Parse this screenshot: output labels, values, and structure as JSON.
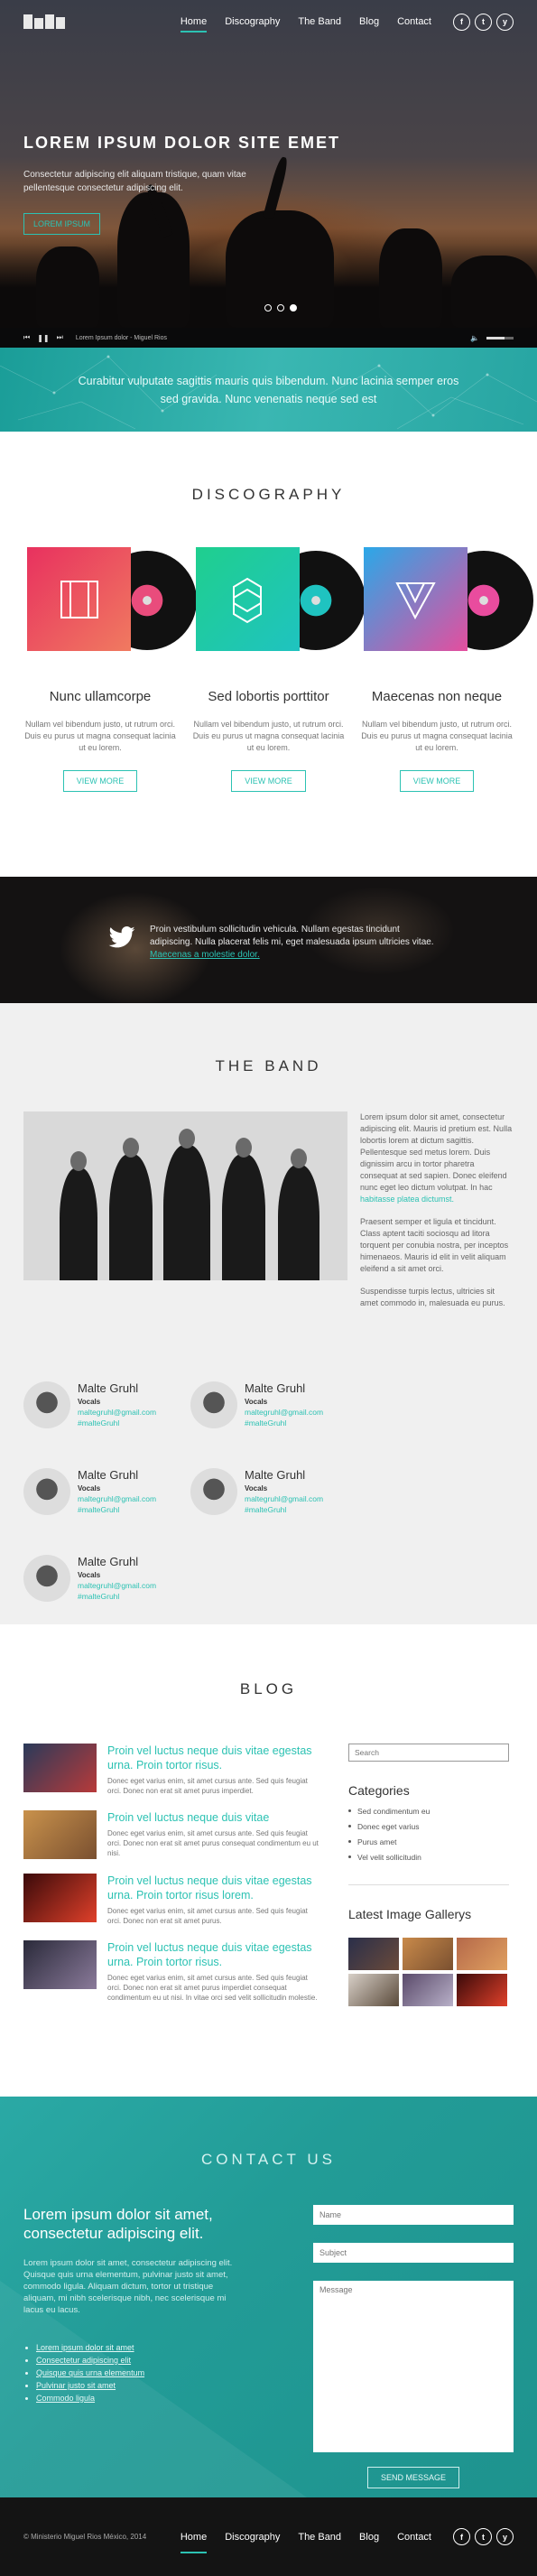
{
  "nav": {
    "items": [
      "Home",
      "Discography",
      "The Band",
      "Blog",
      "Contact"
    ],
    "active": "Home",
    "social": [
      "f",
      "t",
      "y"
    ]
  },
  "hero": {
    "title": "LOREM IPSUM DOLOR SITE EMET",
    "subtitle": "Consectetur adipiscing elit aliquam tristique, quam vitae pellentesque consectetur adipiscing elit.",
    "button": "LOREM IPSUM",
    "player_track": "Lorem Ipsum dolor - Miguel Rios"
  },
  "quote": {
    "text": "Curabitur vulputate sagittis mauris quis bibendum. Nunc lacinia semper eros sed gravida. Nunc venenatis neque sed est"
  },
  "discography": {
    "title": "DISCOGRAPHY",
    "albums": [
      {
        "name": "Nunc ullamcorpe",
        "text": "Nullam vel bibendum justo, ut rutrum orci. Duis eu purus ut magna consequat lacinia ut eu lorem.",
        "button": "VIEW MORE",
        "c1": "#e8315f",
        "c2": "#f07a60",
        "label": "#e94c7c"
      },
      {
        "name": "Sed lobortis porttitor",
        "text": "Nullam vel bibendum justo, ut rutrum orci. Duis eu purus ut magna consequat lacinia ut eu lorem.",
        "button": "VIEW MORE",
        "c1": "#1fcf8e",
        "c2": "#1fc3c0",
        "label": "#1fc3c0"
      },
      {
        "name": "Maecenas non neque",
        "text": "Nullam vel bibendum justo, ut rutrum orci. Duis eu purus ut magna consequat lacinia ut eu lorem.",
        "button": "VIEW MORE",
        "c1": "#2aa8e8",
        "c2": "#e54e9e",
        "label": "#e94c9e"
      }
    ]
  },
  "tweet": {
    "text": "Proin vestibulum sollicitudin vehicula. Nullam egestas tincidunt adipiscing. Nulla placerat felis mi, eget malesuada ipsum ultricies vitae.",
    "link": "Maecenas a molestie dolor."
  },
  "band": {
    "title": "THE BAND",
    "p1": "Lorem ipsum dolor sit amet, consectetur adipiscing elit. Mauris id pretium est. Nulla lobortis lorem at dictum sagittis. Pellentesque sed metus lorem. Duis dignissim arcu in tortor pharetra consequat at sed sapien. Donec eleifend nunc eget leo dictum volutpat. In hac",
    "p1_link": "habitasse platea dictumst.",
    "p2": "Praesent semper et ligula et tincidunt. Class aptent taciti sociosqu ad litora torquent per conubia nostra, per inceptos himenaeos. Mauris id elit in velit aliquam eleifend a sit amet orci.",
    "p3": "Suspendisse turpis lectus, ultricies sit amet commodo in, malesuada eu purus.",
    "members": [
      {
        "name": "Malte Gruhl",
        "role": "Vocals",
        "email": "maltegruhl@gmail.com",
        "tag": "#malteGruhl"
      },
      {
        "name": "Malte Gruhl",
        "role": "Vocals",
        "email": "maltegruhl@gmail.com",
        "tag": "#malteGruhl"
      },
      {
        "name": "Malte Gruhl",
        "role": "Vocals",
        "email": "maltegruhl@gmail.com",
        "tag": "#malteGruhl"
      },
      {
        "name": "Malte Gruhl",
        "role": "Vocals",
        "email": "maltegruhl@gmail.com",
        "tag": "#malteGruhl"
      },
      {
        "name": "Malte Gruhl",
        "role": "Vocals",
        "email": "maltegruhl@gmail.com",
        "tag": "#malteGruhl"
      }
    ]
  },
  "blog": {
    "title": "BLOG",
    "posts": [
      {
        "title": "Proin vel luctus neque duis vitae egestas urna. Proin tortor risus.",
        "text": "Donec eget varius enim, sit amet cursus ante. Sed quis feugiat orci. Donec non erat sit amet purus imperdiet.",
        "c1": "#2a3a5a",
        "c2": "#b83a3a"
      },
      {
        "title": "Proin vel luctus neque duis vitae",
        "text": "Donec eget varius enim, sit amet cursus ante. Sed quis feugiat orci. Donec non erat sit amet purus consequat condimentum eu ut nisi.",
        "c1": "#c9924c",
        "c2": "#7a5030"
      },
      {
        "title": "Proin vel luctus neque duis vitae egestas urna. Proin tortor risus lorem.",
        "text": "Donec eget varius enim, sit amet cursus ante. Sed quis feugiat orci. Donec non erat sit amet purus.",
        "c1": "#3a0a0a",
        "c2": "#e0402a"
      },
      {
        "title": "Proin vel luctus neque duis vitae egestas urna. Proin tortor risus.",
        "text": "Donec eget varius enim, sit amet cursus ante. Sed quis feugiat orci. Donec non erat sit amet purus imperdiet consequat condimentum eu ut nisi. In vitae orci sed velit sollicitudin molestie.",
        "c1": "#2a2a3a",
        "c2": "#8a7a9a"
      }
    ],
    "search_placeholder": "Search",
    "categories_title": "Categories",
    "categories": [
      "Sed condimentum eu",
      "Donec eget varius",
      "Purus amet",
      "Vel velit sollicitudin"
    ],
    "gallery_title": "Latest Image Gallerys",
    "gallery": [
      "#2a2f4a",
      "#c98a4a",
      "#b5694a",
      "#d8d0c8",
      "#5a4a6a",
      "#e0402a"
    ]
  },
  "contact": {
    "title": "CONTACT US",
    "heading": "Lorem ipsum dolor sit amet, consectetur adipiscing elit.",
    "text": "Lorem ipsum dolor sit amet, consectetur adipiscing elit. Quisque quis urna elementum, pulvinar justo sit amet, commodo ligula. Aliquam dictum, tortor ut tristique aliquam, mi nibh scelerisque nibh, nec scelerisque mi lacus eu lacus.",
    "links": [
      "Lorem ipsum dolor sit amet",
      "Consectetur adipiscing elit",
      "Quisque quis urna elementum",
      "Pulvinar justo sit amet",
      "Commodo ligula"
    ],
    "name_placeholder": "Name",
    "subject_placeholder": "Subject",
    "message_placeholder": "Message",
    "send": "SEND MESSAGE"
  },
  "footer": {
    "copyright": "© Ministerio Miguel Rios México, 2014"
  }
}
